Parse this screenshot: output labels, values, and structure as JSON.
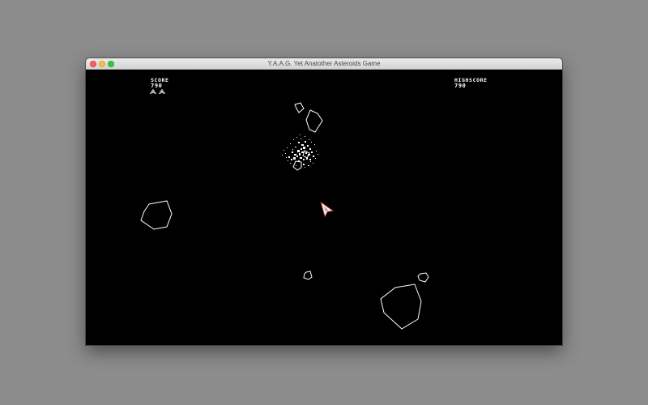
{
  "window": {
    "title": "Y.A.A.G. Yet Anatother Asteroids Game"
  },
  "hud": {
    "score_label": "Score",
    "score_value": "790",
    "highscore_label": "Highscore",
    "highscore_value": "790",
    "lives": 2
  },
  "colors": {
    "background": "#000000",
    "desktop": "#8c8c8c",
    "outline": "#ffffff",
    "ship_accent": "#e04040"
  }
}
